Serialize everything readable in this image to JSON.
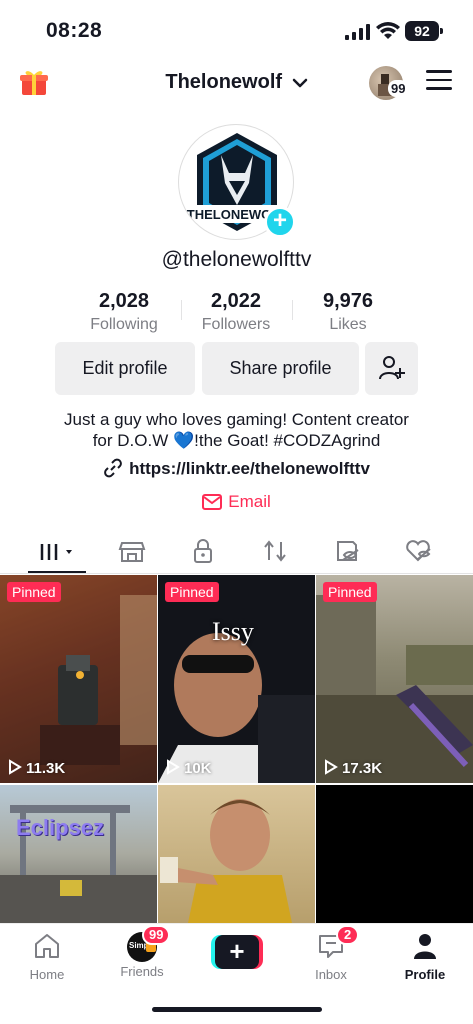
{
  "status_bar": {
    "time": "08:28",
    "battery": "92"
  },
  "header": {
    "title": "Thelonewolf",
    "avatar_count": "99"
  },
  "profile": {
    "avatar_text": "THELONEWOLF",
    "handle": "@thelonewolfttv",
    "stats": [
      {
        "value": "2,028",
        "label": "Following"
      },
      {
        "value": "2,022",
        "label": "Followers"
      },
      {
        "value": "9,976",
        "label": "Likes"
      }
    ],
    "buttons": {
      "edit": "Edit profile",
      "share": "Share profile"
    },
    "bio_line1": "Just a guy who loves gaming! Content creator",
    "bio_line2": "for D.O.W 💙!the Goat! #CODZAgrind",
    "link": "https://linktr.ee/thelonewolfttv",
    "email": "Email"
  },
  "tabs": [
    "videos",
    "shop",
    "private",
    "reposts",
    "hidden",
    "liked"
  ],
  "grid": [
    {
      "pinned": "Pinned",
      "views": "11.3K",
      "caption": ""
    },
    {
      "pinned": "Pinned",
      "views": "10K",
      "caption": "Issy"
    },
    {
      "pinned": "Pinned",
      "views": "17.3K",
      "caption": ""
    },
    {
      "pinned": "",
      "views": "",
      "caption": "Eclipsez"
    },
    {
      "pinned": "",
      "views": "",
      "caption": ""
    },
    {
      "pinned": "",
      "views": "",
      "caption": ""
    }
  ],
  "bottom_nav": {
    "home": "Home",
    "friends": "Friends",
    "friends_badge": "99",
    "friends_avatar_text": "Simp",
    "inbox": "Inbox",
    "inbox_badge": "2",
    "profile": "Profile",
    "plus": "+"
  },
  "colors": {
    "accent": "#fe2c55",
    "cyan": "#25f4ee",
    "badge_blue": "#20d5ec"
  }
}
